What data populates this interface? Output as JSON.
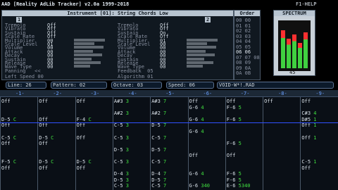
{
  "title": "AAD [Reality AdLib Tracker] v2.0a 1999-2018",
  "help": "F1-HELP",
  "instrument": {
    "header": "Instrument [01]: String Chords Low",
    "op1": "1",
    "op2": "2",
    "params": [
      "Tremolo",
      "Vibrato",
      "Sustain",
      "Scale Rate",
      "Multiplier",
      "Scale Level",
      "Volume",
      "Attack",
      "Decay",
      "Sustain",
      "Release",
      "Wave Type"
    ],
    "left_vals": [
      "Off",
      "Off",
      "Off",
      "Off",
      "00",
      "01",
      "00",
      "00",
      "00",
      "00",
      "00",
      "00"
    ],
    "right_vals": [
      "Off",
      "Off",
      "On",
      "Off",
      "01",
      "00",
      "00",
      "00",
      "00",
      "00",
      "00",
      "00"
    ],
    "footer_left": [
      [
        "Panning",
        "<<"
      ],
      [
        "Left Speed",
        "00"
      ]
    ],
    "footer_right": [
      [
        "Feedback",
        "05"
      ],
      [
        "Algorithm",
        "01"
      ]
    ]
  },
  "order": {
    "label": "Order",
    "rows": [
      "00",
      "01",
      "02",
      "03",
      "04",
      "05",
      "06",
      "07",
      "08",
      "09",
      "0A"
    ],
    "values": [
      "00",
      "01",
      "02",
      "03",
      "04",
      "05",
      "06",
      "07 08",
      "09",
      "0A",
      "0B"
    ]
  },
  "spectrum": {
    "label": "SPECTRUM",
    "value": "45"
  },
  "status": {
    "line": "Line: 26",
    "pattern": "Pattern: 02",
    "octave": "Octave: 03",
    "speed": "Speed: 06",
    "file": "VOID-W*!.RAD"
  },
  "channels": [
    "1",
    "2",
    "3",
    "4",
    "5",
    "6",
    "7",
    "8",
    "9"
  ],
  "rows": [
    [
      "Off",
      "Off",
      "Off",
      "A#3 3",
      "A#3 7",
      "Off",
      "Off",
      "Off",
      "Off"
    ],
    [
      "",
      "",
      "",
      "",
      "",
      "G-6 4",
      "F-6 5",
      "",
      ""
    ],
    [
      "",
      "",
      "",
      "A#2 3",
      "A#2 7",
      "",
      "",
      "",
      "C#3 4"
    ],
    [
      "D-5 C",
      "Off",
      "F-4 C",
      "",
      "",
      "G-6 4",
      "F-6 5",
      "",
      "D#5 1"
    ],
    [
      "Off",
      "Off",
      "Off",
      "C-5 3",
      "D-5 7",
      "",
      "",
      "",
      "Off 1"
    ],
    [
      "",
      "",
      "",
      "",
      "",
      "G-6 4",
      "",
      "",
      ""
    ],
    [
      "C-5 C",
      "D-5 C",
      "Off",
      "C-5 3",
      "C-5 7",
      "",
      "",
      "",
      "Off 1"
    ],
    [
      "Off",
      "Off",
      "",
      "",
      "",
      "",
      "F-6 5",
      "",
      ""
    ],
    [
      "",
      "",
      "",
      "D-5 3",
      "D-5 7",
      "",
      "",
      "",
      ""
    ],
    [
      "",
      "",
      "",
      "",
      "",
      "Off",
      "Off",
      "",
      ""
    ],
    [
      "F-5 C",
      "D-5 C",
      "D-5 C",
      "C-5 3",
      "C-5 7",
      "",
      "",
      "",
      "C-5 1"
    ],
    [
      "Off",
      "Off",
      "Off",
      "",
      "",
      "",
      "",
      "",
      "Off"
    ],
    [
      "",
      "",
      "",
      "D-4 3",
      "D-4 7",
      "G-6 4",
      "F-6 5",
      "",
      ""
    ],
    [
      "",
      "",
      "",
      "D-5 3",
      "D-5 7",
      "",
      "F-6 5",
      "",
      ""
    ],
    [
      "",
      "",
      "",
      "C-5 3",
      "C-5 7",
      "G-6 340",
      "E-6 5340",
      "",
      ""
    ]
  ]
}
